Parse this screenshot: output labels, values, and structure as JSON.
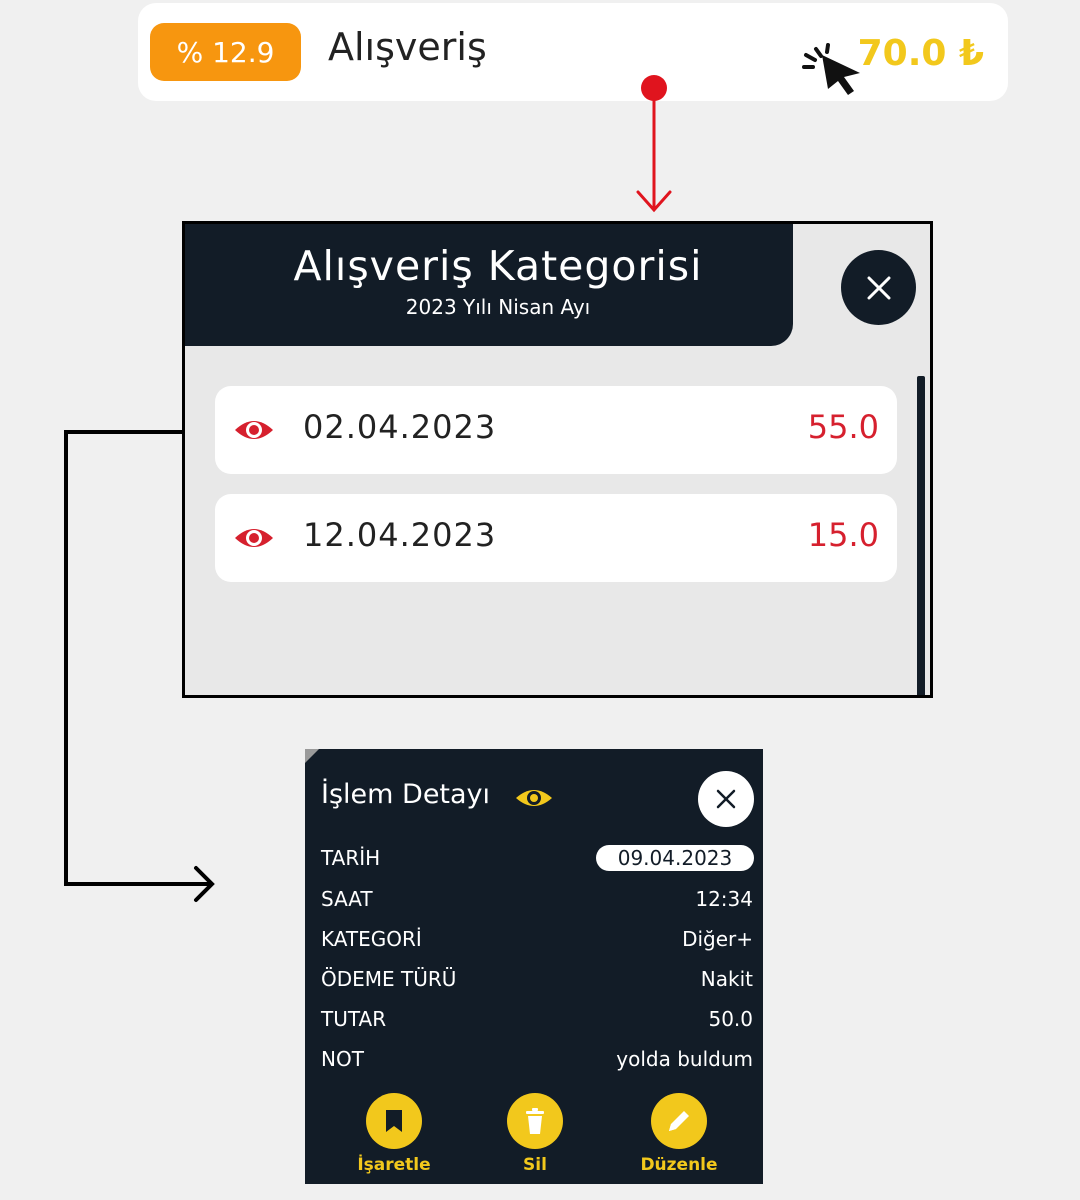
{
  "category_row": {
    "percent": "% 12.9",
    "name": "Alışveriş",
    "amount": "70.0 ₺"
  },
  "category_dialog": {
    "title": "Alışveriş Kategorisi",
    "subtitle": "2023 Yılı  Nisan Ayı",
    "close_icon": "close-icon",
    "transactions": [
      {
        "date": "02.04.2023",
        "amount": "55.0",
        "icon": "eye-icon"
      },
      {
        "date": "12.04.2023",
        "amount": "15.0",
        "icon": "eye-icon"
      }
    ]
  },
  "detail_panel": {
    "title": "İşlem Detayı",
    "fields": [
      {
        "label": "TARİH",
        "value": "09.04.2023"
      },
      {
        "label": "SAAT",
        "value": "12:34"
      },
      {
        "label": "KATEGORİ",
        "value": "Diğer+"
      },
      {
        "label": "ÖDEME TÜRÜ",
        "value": "Nakit"
      },
      {
        "label": "TUTAR",
        "value": "50.0"
      },
      {
        "label": "NOT",
        "value": "yolda buldum"
      }
    ],
    "actions": [
      {
        "label": "İşaretle",
        "icon": "bookmark-icon"
      },
      {
        "label": "Sil",
        "icon": "trash-icon"
      },
      {
        "label": "Düzenle",
        "icon": "pencil-icon"
      }
    ]
  },
  "colors": {
    "dark": "#121c27",
    "accent_yellow": "#f2c81c",
    "badge_orange": "#f7960f",
    "amount_red": "#d6202e",
    "arrow_red": "#e0141e"
  }
}
